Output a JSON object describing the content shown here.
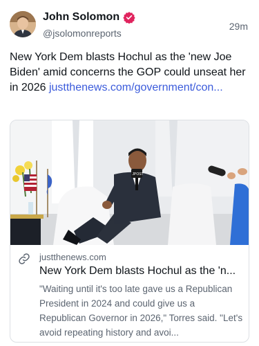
{
  "post": {
    "author_name": "John Solomon",
    "handle": "@jsolomonreports",
    "timestamp": "29m",
    "text": "New York Dem blasts Hochul as the 'new Joe Biden' amid concerns the GOP could unseat her in 2026",
    "link_text": "justthenews.com/government/con...",
    "verified_color": "#e0245e",
    "link_color": "#3b5bdb"
  },
  "card": {
    "domain": "justthenews.com",
    "title": "New York Dem blasts Hochul as the 'n...",
    "description": "\"Waiting until it's too late gave us a Republican President in 2024 and could give us a Republican Governor in 2026,\" Torres said. \"Let's avoid repeating history and avoi...",
    "image_mic_label": "JPOST",
    "icon": "link-icon"
  }
}
